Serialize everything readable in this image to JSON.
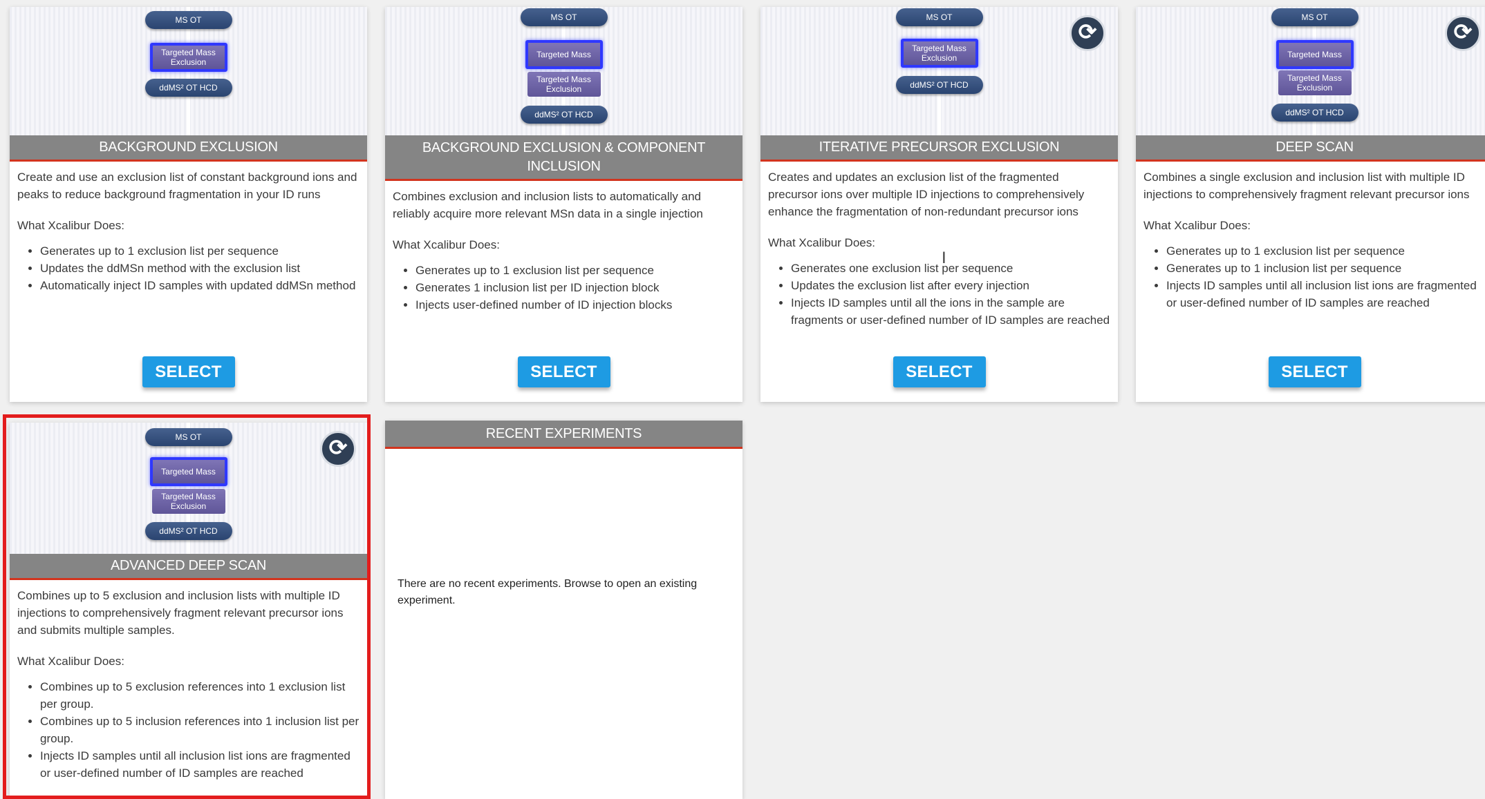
{
  "diagram_labels": {
    "ms_ot": "MS OT",
    "targeted_mass": "Targeted Mass",
    "targeted_mass_exclusion": "Targeted Mass Exclusion",
    "ddms2": "ddMS² OT HCD"
  },
  "select_label": "SELECT",
  "what_does_label": "What Xcalibur Does:",
  "cards": [
    {
      "title": "BACKGROUND EXCLUSION",
      "description": "Create and use an exclusion list of constant background ions and peaks to reduce background fragmentation in your ID runs",
      "bullets": [
        "Generates up to 1 exclusion list per sequence",
        "Updates the ddMSn method with the exclusion list",
        "Automatically inject ID samples with updated ddMSn method"
      ]
    },
    {
      "title": "BACKGROUND EXCLUSION & COMPONENT INCLUSION",
      "description": "Combines exclusion and inclusion lists to automatically and reliably acquire more relevant MSn data in a single injection",
      "bullets": [
        "Generates up to 1 exclusion list per sequence",
        "Generates 1 inclusion list per ID injection block",
        "Injects user-defined number of ID injection blocks"
      ]
    },
    {
      "title": "ITERATIVE PRECURSOR EXCLUSION",
      "description": "Creates and updates an exclusion list of the fragmented precursor ions over multiple ID injections to comprehensively enhance the fragmentation of non-redundant precursor ions",
      "bullets": [
        "Generates one exclusion list per sequence",
        "Updates the exclusion list after every injection",
        "Injects ID samples until all the ions in the sample are fragments or user-defined number of ID samples are reached"
      ]
    },
    {
      "title": "DEEP SCAN",
      "description": "Combines a single exclusion and inclusion list with multiple ID injections to comprehensively fragment relevant precursor ions",
      "bullets": [
        "Generates up to 1 exclusion list per sequence",
        "Generates up to 1 inclusion list per sequence",
        "Injects ID samples until all inclusion list ions are fragmented or user-defined number of ID samples are reached"
      ]
    },
    {
      "title": "ADVANCED DEEP SCAN",
      "description": "Combines up to 5 exclusion and inclusion lists with multiple ID injections to comprehensively fragment relevant precursor ions and submits multiple samples.",
      "bullets": [
        "Combines up to 5 exclusion references into 1 exclusion list per group.",
        "Combines up to 5 inclusion references into 1 inclusion list per group.",
        "Injects ID samples until all inclusion list ions are fragmented or user-defined number of ID samples are reached"
      ]
    }
  ],
  "recent": {
    "title": "RECENT EXPERIMENTS",
    "empty_message": "There are no recent experiments. Browse to open an existing experiment."
  },
  "colors": {
    "band": "#858585",
    "band_underline": "#d2341e",
    "select_button": "#1e9be3",
    "highlight_border": "#e31d1d",
    "node_pill": "#2a4470",
    "node_box": "#6a60a5"
  },
  "icons": {
    "cycle": "iteration-cycle-icon",
    "cursor": "text-cursor-icon"
  }
}
